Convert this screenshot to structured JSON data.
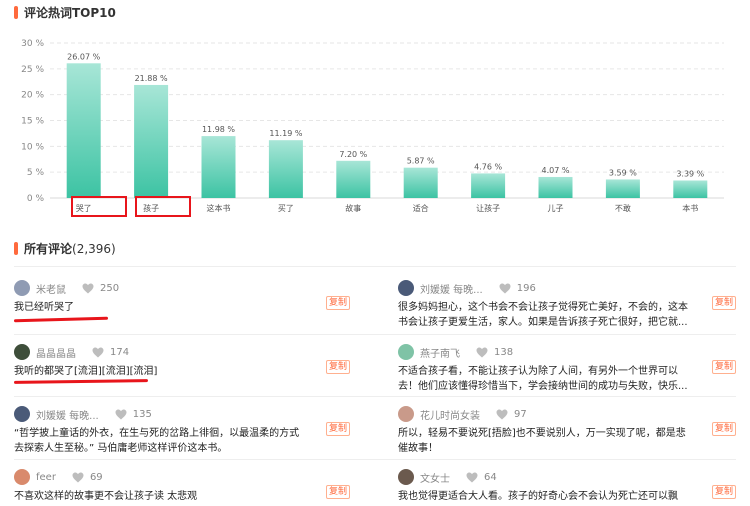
{
  "section_chart_title": "评论热词TOP10",
  "section_comments": {
    "title": "所有评论",
    "count": "(2,396)"
  },
  "chart_data": {
    "type": "bar",
    "title": "评论热词TOP10",
    "categories": [
      "哭了",
      "孩子",
      "这本书",
      "买了",
      "故事",
      "适合",
      "让孩子",
      "儿子",
      "不敢",
      "本书"
    ],
    "values": [
      26.07,
      21.88,
      11.98,
      11.19,
      7.2,
      5.87,
      4.76,
      4.07,
      3.59,
      3.39
    ],
    "value_labels": [
      "26.07 %",
      "21.88 %",
      "11.98 %",
      "11.19 %",
      "7.20 %",
      "5.87 %",
      "4.76 %",
      "4.07 %",
      "3.59 %",
      "3.39 %"
    ],
    "y_ticks": [
      "0 %",
      "5 %",
      "10 %",
      "15 %",
      "20 %",
      "25 %",
      "30 %"
    ],
    "ylim": [
      0,
      30
    ],
    "grid": true,
    "colors": {
      "bar_top": "#a8e6d7",
      "bar_bottom": "#3cc3a3",
      "grid": "#e6e6e6"
    }
  },
  "comments": [
    {
      "user": "米老鼠",
      "likes": "250",
      "text": "我已经听哭了",
      "copy": "复制",
      "avatar_color": "#8f9bb3"
    },
    {
      "user": "刘媛媛 每晚...",
      "likes": "196",
      "text": "很多妈妈担心，这个书会不会让孩子觉得死亡美好，不会的，这本书会让孩子更爱生活，家人。如果是告诉孩子死亡很好，把它就...",
      "copy": "复制",
      "avatar_color": "#4a5a78"
    },
    {
      "user": "晶晶晶晶",
      "likes": "174",
      "text": "我听的都哭了[流泪][流泪][流泪]",
      "copy": "复制",
      "avatar_color": "#3e4e3a"
    },
    {
      "user": "燕子南飞",
      "likes": "138",
      "text": "不适合孩子看，不能让孩子认为除了人间，有另外一个世界可以去！他们应该懂得珍惜当下，学会接纳世间的成功与失败，快乐...",
      "copy": "复制",
      "avatar_color": "#7fc3a6"
    },
    {
      "user": "刘媛媛 每晚...",
      "likes": "135",
      "text": "“哲学披上童话的外衣，在生与死的岔路上徘徊，以最温柔的方式去探索人生至秘。” 马伯庸老师这样评价这本书。",
      "copy": "复制",
      "avatar_color": "#4a5a78"
    },
    {
      "user": "花儿时尚女装",
      "likes": "97",
      "text": "所以，轻易不要说死[捂脸]也不要说别人，万一实现了呢，都是悲催故事！",
      "copy": "复制",
      "avatar_color": "#c99a8a"
    },
    {
      "user": "feer",
      "likes": "69",
      "text": "不喜欢这样的故事更不会让孩子读 太悲观",
      "copy": "复制",
      "avatar_color": "#d98a6c"
    },
    {
      "user": "文女士",
      "likes": "64",
      "text": "我也觉得更适合大人看。孩子的好奇心会不会认为死亡还可以飘",
      "copy": "复制",
      "avatar_color": "#6b5a4e"
    }
  ]
}
